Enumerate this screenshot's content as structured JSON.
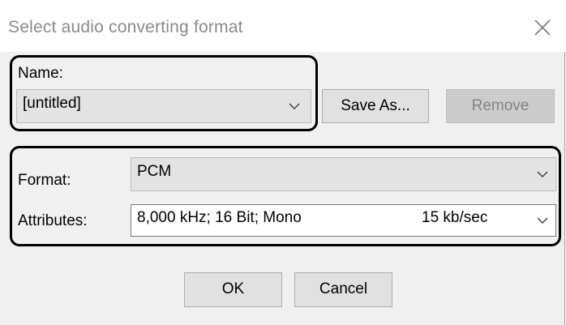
{
  "dialog": {
    "title": "Select audio converting format",
    "close_icon": "close-icon"
  },
  "name_section": {
    "label": "Name:",
    "value": "[untitled]",
    "save_as_label": "Save As...",
    "remove_label": "Remove"
  },
  "format_section": {
    "format_label": "Format:",
    "format_value": "PCM",
    "attributes_label": "Attributes:",
    "attributes_value": "8,000 kHz; 16 Bit; Mono",
    "attributes_rate": "15 kb/sec"
  },
  "buttons": {
    "ok_label": "OK",
    "cancel_label": "Cancel"
  },
  "colors": {
    "highlight_border": "#000000",
    "dialog_bg": "#f0f0f0",
    "disabled_text": "#838383"
  }
}
